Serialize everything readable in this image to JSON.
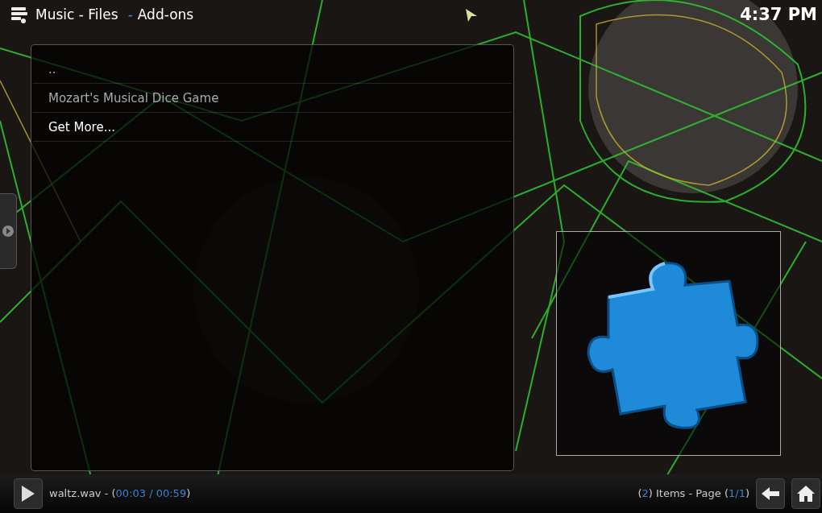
{
  "header": {
    "breadcrumb": [
      {
        "text": "Music - Files",
        "kind": "plain"
      },
      {
        "text": "-",
        "kind": "separator"
      },
      {
        "text": "Add-ons",
        "kind": "plain"
      }
    ],
    "clock": "4:37 PM"
  },
  "list": {
    "items": [
      {
        "label": "..",
        "selected": false
      },
      {
        "label": "Mozart's Musical Dice Game",
        "selected": false
      },
      {
        "label": "Get More...",
        "selected": true
      }
    ]
  },
  "footer": {
    "now_playing": [
      {
        "text": "waltz.wav - (",
        "highlight": false
      },
      {
        "text": "00:03 / 00:59",
        "highlight": true
      },
      {
        "text": ")",
        "highlight": false
      }
    ],
    "page_info": [
      {
        "text": "(",
        "highlight": false
      },
      {
        "text": "2",
        "highlight": true
      },
      {
        "text": ") Items - Page (",
        "highlight": false
      },
      {
        "text": "1/1",
        "highlight": true
      },
      {
        "text": ")",
        "highlight": false
      }
    ]
  }
}
